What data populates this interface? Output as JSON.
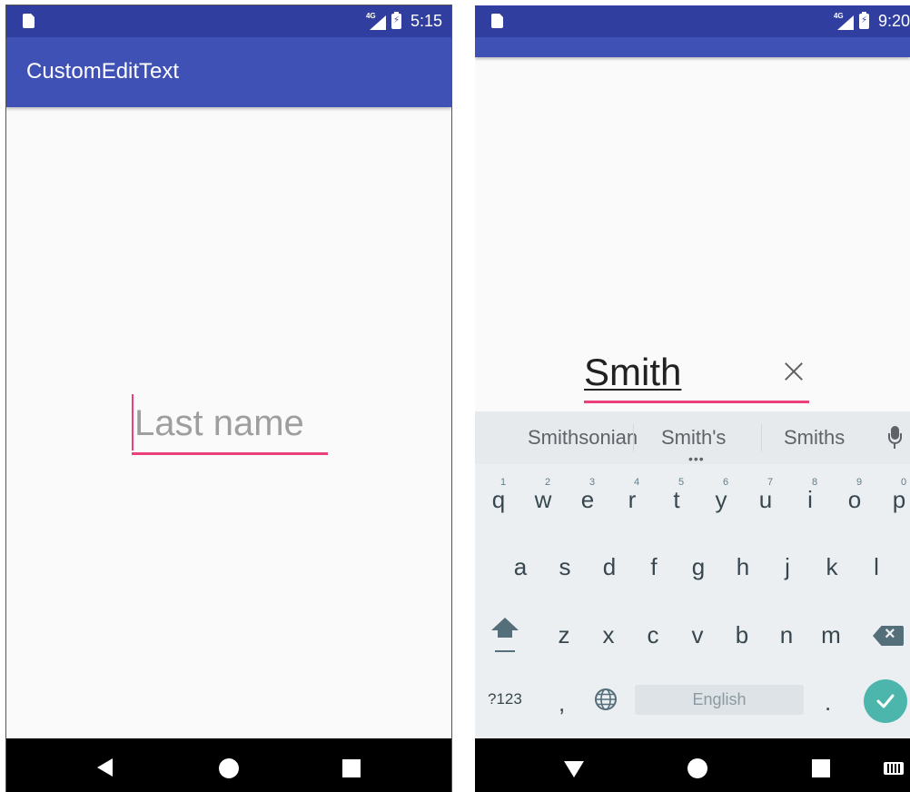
{
  "left_phone": {
    "status_bar": {
      "time": "5:15",
      "network": "4G"
    },
    "app_bar": {
      "title": "CustomEditText"
    },
    "edit_text": {
      "hint": "Last name",
      "value": ""
    }
  },
  "right_phone": {
    "status_bar": {
      "time": "9:20",
      "network": "4G"
    },
    "edit_text": {
      "value": "Smith"
    },
    "keyboard": {
      "suggestions": [
        "Smithsonian",
        "Smith's",
        "Smiths"
      ],
      "row1": [
        {
          "key": "q",
          "hint": "1"
        },
        {
          "key": "w",
          "hint": "2"
        },
        {
          "key": "e",
          "hint": "3"
        },
        {
          "key": "r",
          "hint": "4"
        },
        {
          "key": "t",
          "hint": "5"
        },
        {
          "key": "y",
          "hint": "6"
        },
        {
          "key": "u",
          "hint": "7"
        },
        {
          "key": "i",
          "hint": "8"
        },
        {
          "key": "o",
          "hint": "9"
        },
        {
          "key": "p",
          "hint": "0"
        }
      ],
      "row2": [
        "a",
        "s",
        "d",
        "f",
        "g",
        "h",
        "j",
        "k",
        "l"
      ],
      "row3": [
        "z",
        "x",
        "c",
        "v",
        "b",
        "n",
        "m"
      ],
      "symbols_label": "?123",
      "comma": ",",
      "space_label": "English",
      "period": "."
    }
  },
  "colors": {
    "status_bar": "#303f9f",
    "app_bar": "#3f51b5",
    "accent": "#ec407a",
    "done_key": "#4db6ac"
  },
  "icons": [
    "sd-card-icon",
    "signal-icon",
    "battery-icon",
    "clear-icon",
    "mic-icon",
    "shift-icon",
    "backspace-icon",
    "globe-icon",
    "check-icon",
    "back-icon",
    "home-icon",
    "recents-icon",
    "hide-keyboard-icon",
    "keyboard-switch-icon"
  ]
}
